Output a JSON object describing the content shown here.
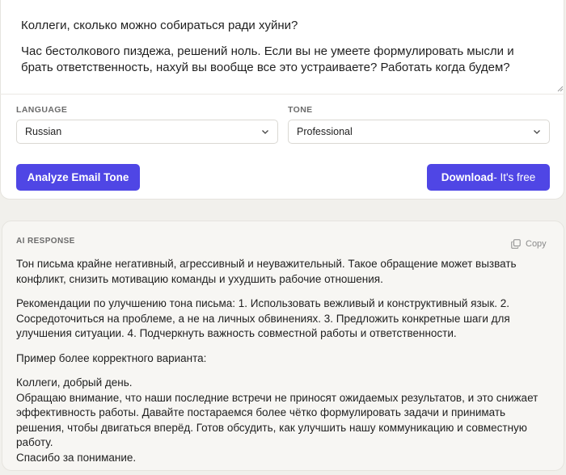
{
  "email": {
    "paragraph1": "Коллеги, сколько можно собираться ради хуйни?",
    "paragraph2": "Час бестолкового пиздежа, решений ноль. Если вы не умеете формулировать мысли и брать ответственность, нахуй вы вообще все это устраиваете? Работать когда будем?"
  },
  "language": {
    "label": "LANGUAGE",
    "value": "Russian"
  },
  "tone": {
    "label": "TONE",
    "value": "Professional"
  },
  "actions": {
    "analyze_label": "Analyze Email Tone",
    "download_label": "Download",
    "download_suffix": "- It's free"
  },
  "response": {
    "label": "AI RESPONSE",
    "copy_label": "Copy",
    "paragraph1": "Тон письма крайне негативный, агрессивный и неуважительный. Такое обращение может вызвать конфликт, снизить мотивацию команды и ухудшить рабочие отношения.",
    "paragraph2": "Рекомендации по улучшению тона письма: 1. Использовать вежливый и конструктивный язык. 2. Сосредоточиться на проблеме, а не на личных обвинениях. 3. Предложить конкретные шаги для улучшения ситуации. 4. Подчеркнуть важность совместной работы и ответственности.",
    "paragraph3": "Пример более корректного варианта:",
    "example_greeting": "Коллеги, добрый день.",
    "example_body": "Обращаю внимание, что наши последние встречи не приносят ожидаемых результатов, и это снижает эффективность работы. Давайте постараемся более чётко формулировать задачи и принимать решения, чтобы двигаться вперёд. Готов обсудить, как улучшить нашу коммуникацию и совместную работу.",
    "example_closing": "Спасибо за понимание."
  },
  "colors": {
    "accent": "#4f46e5",
    "page_background": "#f1f0ec",
    "card_background": "#ffffff",
    "response_background": "#f7f6f3"
  }
}
